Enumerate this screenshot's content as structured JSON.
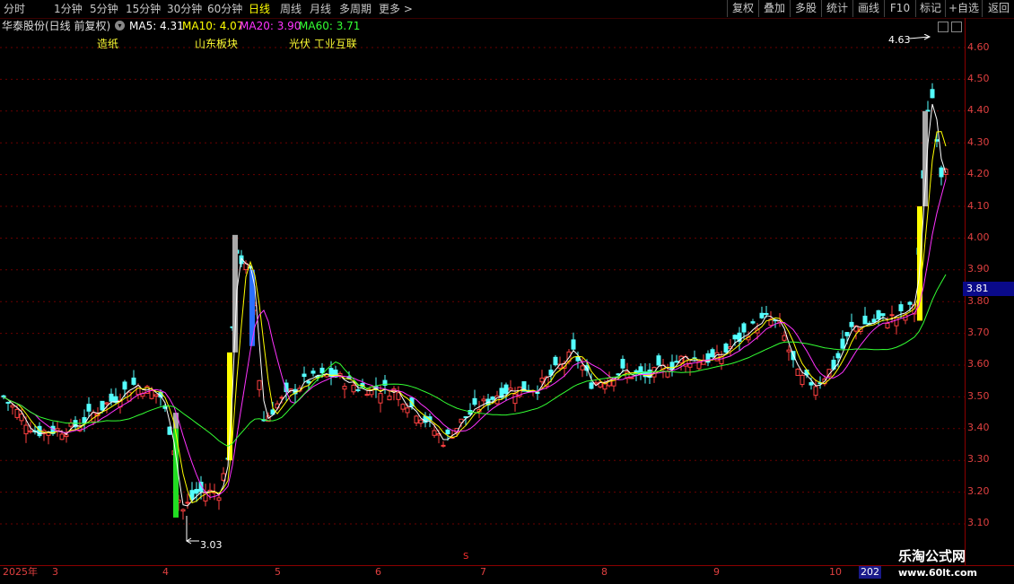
{
  "toolbar": {
    "left_items": [
      "分时",
      "1分钟",
      "5分钟",
      "15分钟",
      "30分钟",
      "60分钟",
      "日线",
      "周线",
      "月线",
      "多周期",
      "更多 >"
    ],
    "active_index": 6,
    "right_items": [
      "复权",
      "叠加",
      "多股",
      "统计",
      "画线",
      "F10",
      "标记",
      "+自选",
      "返回"
    ]
  },
  "info": {
    "title": "华泰股份(日线 前复权)",
    "ma5": "MA5: 4.31",
    "ma10": "MA10: 4.07",
    "ma20": "MA20: 3.90",
    "ma60": "MA60: 3.71",
    "colors": {
      "ma5": "#ffffff",
      "ma10": "#ffff00",
      "ma20": "#ff33ff",
      "ma60": "#33ff33"
    }
  },
  "tags": [
    "造纸",
    "山东板块",
    "光伏 工业互联"
  ],
  "price_axis": {
    "labels": [
      "4.60",
      "4.50",
      "4.40",
      "4.30",
      "4.20",
      "4.10",
      "4.00",
      "3.90",
      "3.80",
      "3.70",
      "3.60",
      "3.50",
      "3.40",
      "3.30",
      "3.20",
      "3.10"
    ],
    "current": "3.81"
  },
  "date_axis": {
    "labels": [
      "2025年",
      "3",
      "4",
      "5",
      "6",
      "7",
      "8",
      "9",
      "10",
      "202"
    ]
  },
  "annotations": {
    "high": "4.63",
    "low": "3.03",
    "marker": "S"
  },
  "watermark": {
    "line1": "乐淘公式网",
    "line2": "www.60lt.com"
  },
  "chart_data": {
    "type": "candlestick",
    "ylim": [
      3.05,
      4.65
    ],
    "high_marker": 4.63,
    "low_marker": 3.03,
    "current_price": 3.81,
    "ma_latest": {
      "MA5": 4.31,
      "MA10": 4.07,
      "MA20": 3.9,
      "MA60": 3.71
    }
  }
}
